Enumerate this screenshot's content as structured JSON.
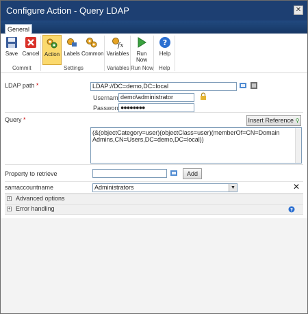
{
  "window": {
    "title": "Configure Action - Query LDAP",
    "close_glyph": "✕"
  },
  "tabs": [
    {
      "label": "General"
    }
  ],
  "ribbon": {
    "buttons": [
      {
        "label": "Save",
        "icon": "floppy-disk-icon"
      },
      {
        "label": "Cancel",
        "icon": "red-x-icon"
      },
      {
        "label": "Action",
        "icon": "action-gears-icon"
      },
      {
        "label": "Labels",
        "icon": "labels-icon"
      },
      {
        "label": "Common",
        "icon": "common-gears-icon"
      },
      {
        "label": "Variables",
        "icon": "fx-variables-icon"
      },
      {
        "label": "Run Now",
        "icon": "play-icon"
      },
      {
        "label": "Help",
        "icon": "help-icon"
      }
    ],
    "groups": [
      "Commit",
      "Settings",
      "Variables",
      "Run Now",
      "Help"
    ]
  },
  "form": {
    "ldap_label": "LDAP path",
    "ldap_value": "LDAP://DC=demo,DC=local",
    "username_label": "Username",
    "username_value": "demo\\administrator",
    "password_label": "Password",
    "password_value": "●●●●●●●●",
    "query_label": "Query",
    "insert_reference_label": "Insert Reference",
    "query_value": "(&(objectCategory=user)(objectClass=user)(memberOf=CN=Domain Admins,CN=Users,DC=demo,DC=local))",
    "property_label": "Property to retrieve",
    "property_value": "",
    "add_label": "Add",
    "sam_label": "samaccountname",
    "sam_value": "Administrators",
    "sam_remove": "✕",
    "advanced_label": "Advanced options",
    "error_label": "Error handling"
  },
  "colors": {
    "titlebar": "#1d3f72",
    "required": "#cc0000",
    "active_button": "#fbd96d"
  }
}
